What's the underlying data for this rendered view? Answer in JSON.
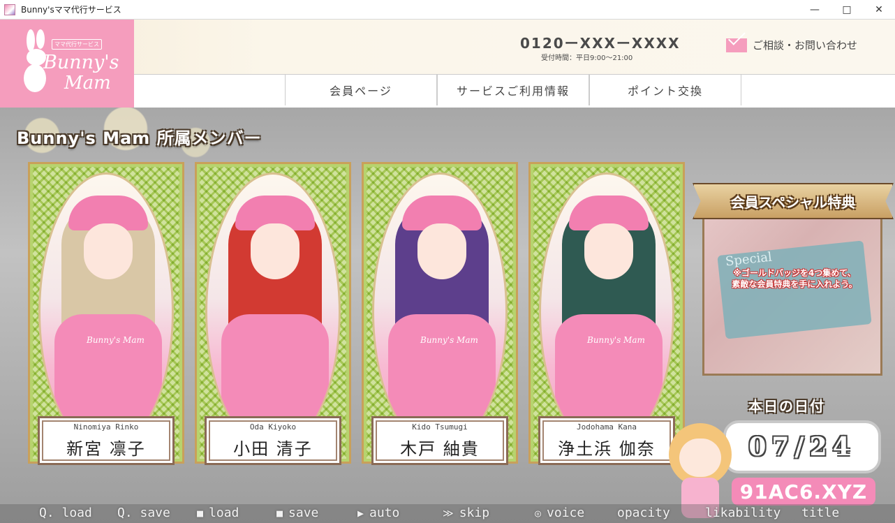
{
  "window": {
    "title": "Bunny'sママ代行サービス",
    "minimize": "—",
    "maximize": "□",
    "close": "✕"
  },
  "header": {
    "logo_small": "ママ代行サービス",
    "logo_line1": "Bunny's",
    "logo_line2": "Mam",
    "phone": "0120ーXXXーXXXX",
    "hours": "受付時間：平日9:00～21:00",
    "contact": "ご相談・お問い合わせ",
    "nav": [
      "会員ページ",
      "サービスご利用情報",
      "ポイント交換"
    ]
  },
  "main": {
    "section_title": "Bunny's Mam 所属メンバー",
    "members": [
      {
        "romaji": "Ninomiya Rinko",
        "kanji": "新宮 凛子",
        "hair_color": "#d9c7a6"
      },
      {
        "romaji": "Oda Kiyoko",
        "kanji": "小田 清子",
        "hair_color": "#d23a32"
      },
      {
        "romaji": "Kido Tsumugi",
        "kanji": "木戸 紬貴",
        "hair_color": "#5d3f8c"
      },
      {
        "romaji": "Jodohama Kana",
        "kanji": "浄土浜 伽奈",
        "hair_color": "#2f5a52"
      }
    ],
    "apron_logo": "Bunny's Mam",
    "special": {
      "title": "会員スペシャル特典",
      "ticket_text": "Special",
      "note_line1": "※ゴールドバッジを4つ集めて、",
      "note_line2": "素敵な会員特典を手に入れよう。"
    },
    "date_label": "本日の日付",
    "date_value": "07/24",
    "watermark": "91AC6.XYZ"
  },
  "controls": [
    {
      "label": "Q. load",
      "icon": "",
      "name": "qload"
    },
    {
      "label": "Q. save",
      "icon": "",
      "name": "qsave"
    },
    {
      "label": "load",
      "icon": "■",
      "name": "load"
    },
    {
      "label": "save",
      "icon": "■",
      "name": "save"
    },
    {
      "label": "auto",
      "icon": "▶",
      "name": "auto"
    },
    {
      "label": "skip",
      "icon": "≫",
      "name": "skip"
    },
    {
      "label": "voice",
      "icon": "◎",
      "name": "voice"
    },
    {
      "label": "opacity",
      "icon": "",
      "name": "opacity"
    },
    {
      "label": "likability",
      "icon": "",
      "name": "likability"
    },
    {
      "label": "title",
      "icon": "",
      "name": "title"
    }
  ],
  "colors": {
    "brand_pink": "#f59dbd",
    "card_green": "#b7d36e",
    "frame_gold": "#c9a05a"
  }
}
